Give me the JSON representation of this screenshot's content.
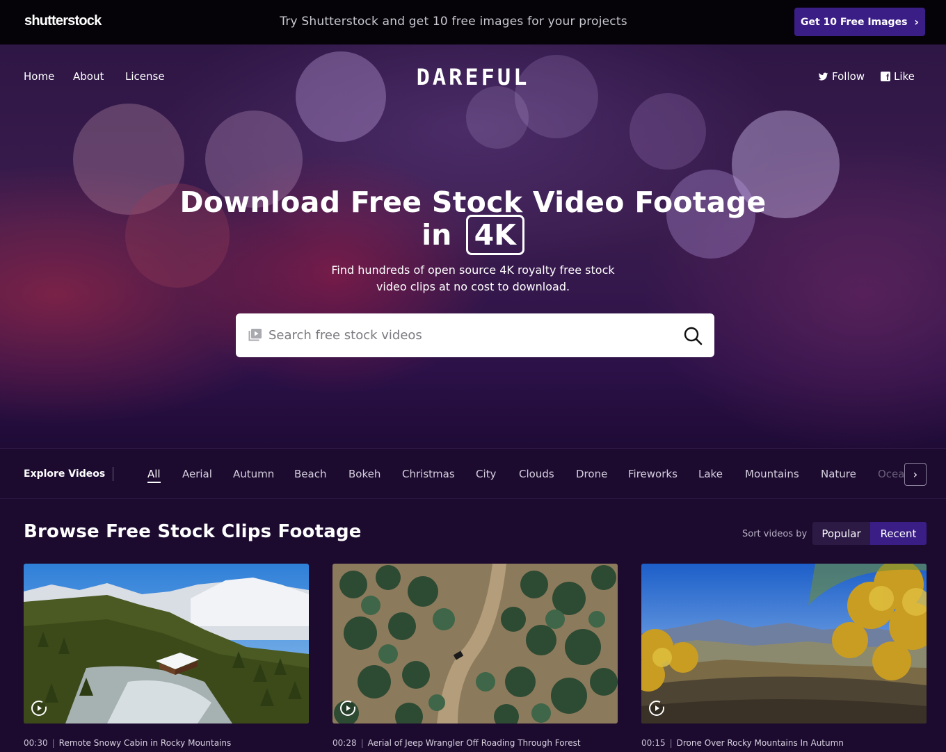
{
  "promo": {
    "brand": "shutterstock",
    "text": "Try Shutterstock and get 10 free images for your projects",
    "cta_label": "Get 10 Free Images",
    "cta_chevron": "›"
  },
  "nav": {
    "items": [
      "Home",
      "About",
      "License"
    ],
    "logo": "DAREFUL",
    "social": [
      {
        "label": "Follow",
        "icon": "twitter-icon"
      },
      {
        "label": "Like",
        "icon": "facebook-icon"
      }
    ]
  },
  "hero": {
    "headline_line1": "Download Free Stock Video Footage",
    "headline_in": "in",
    "headline_badge": "4K",
    "subline_1": "Find hundreds of open source 4K royalty free stock",
    "subline_2": "video clips at no cost to download.",
    "search_placeholder": "Search free stock videos",
    "search_value": ""
  },
  "explore": {
    "label": "Explore Videos",
    "categories": [
      "All",
      "Aerial",
      "Autumn",
      "Beach",
      "Bokeh",
      "Christmas",
      "City",
      "Clouds",
      "Drone",
      "Fireworks",
      "Lake",
      "Mountains",
      "Nature",
      "Ocean"
    ],
    "active": "All",
    "next_glyph": "›"
  },
  "browse": {
    "title": "Browse Free Stock Clips Footage",
    "sort_label": "Sort videos by",
    "sort_options": [
      "Popular",
      "Recent"
    ],
    "sort_selected": "Recent",
    "cards": [
      {
        "duration": "00:30",
        "title": "Remote Snowy Cabin in Rocky Mountains"
      },
      {
        "duration": "00:28",
        "title": "Aerial of Jeep Wrangler Off Roading Through Forest"
      },
      {
        "duration": "00:15",
        "title": "Drone Over Rocky Mountains In Autumn"
      }
    ]
  },
  "colors": {
    "promo_bg": "#050307",
    "cta_bg": "#3a1e86",
    "page_bg": "#1c0b2f",
    "sort_selected_bg": "#3a1e86"
  }
}
